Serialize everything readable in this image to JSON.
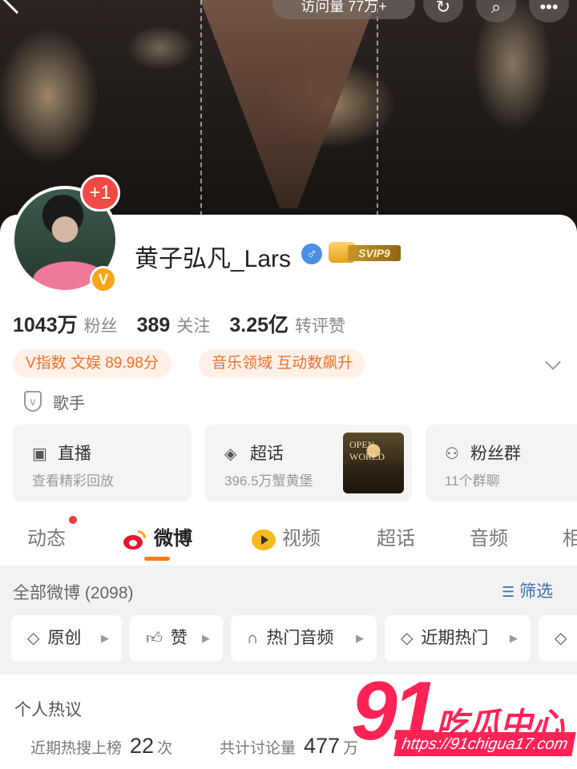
{
  "header": {
    "visit_label": "访问量 77万+",
    "icons": [
      "back-icon",
      "refresh-icon",
      "search-icon",
      "more-icon"
    ]
  },
  "profile": {
    "name": "黄子弘凡_Lars",
    "avatar_badge": "+1",
    "verified_badge": "V",
    "gender_symbol": "♂",
    "vip_label": "SVIP9",
    "stats": [
      {
        "value": "1043万",
        "label": "粉丝"
      },
      {
        "value": "389",
        "label": "关注"
      },
      {
        "value": "3.25亿",
        "label": "转评赞"
      }
    ],
    "chips": [
      "V指数 文娱 89.98分",
      "音乐领域 互动数飙升"
    ],
    "role": "歌手"
  },
  "tiles": [
    {
      "icon": "live-icon",
      "title": "直播",
      "subtitle": "查看精彩回放"
    },
    {
      "icon": "supertopic-icon",
      "title": "超话",
      "subtitle": "396.5万蟹黄堡",
      "thumb_text": "OPEN WORLD"
    },
    {
      "icon": "fans-group-icon",
      "title": "粉丝群",
      "subtitle": "11个群聊"
    }
  ],
  "tabs": [
    "动态",
    "微博",
    "视频",
    "超话",
    "音频",
    "相"
  ],
  "active_tab": "微博",
  "feed": {
    "title": "全部微博 (2098)",
    "filter_label": "筛选",
    "pills": [
      "原创",
      "赞",
      "热门音频",
      "近期热门"
    ],
    "hot_title": "个人热议",
    "hot_stats": [
      {
        "label": "近期热搜上榜",
        "value": "22",
        "unit": "次"
      },
      {
        "label": "共计讨论量",
        "value": "477",
        "unit": "万"
      }
    ]
  },
  "watermark": {
    "number": "91",
    "text": "吃瓜中心",
    "url": "https://91chigua17.com"
  },
  "colors": {
    "accent_orange": "#ff7a1a",
    "chip_text": "#f2702b",
    "link_blue": "#3a6fb0",
    "weibo_red": "#e6162d",
    "watermark_pink": "#ff2255"
  }
}
